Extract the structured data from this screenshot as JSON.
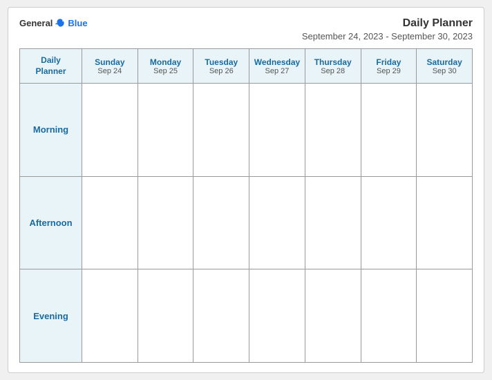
{
  "header": {
    "logo_general": "General",
    "logo_blue": "Blue",
    "title": "Daily Planner",
    "date_range": "September 24, 2023 - September 30, 2023"
  },
  "grid": {
    "corner_label_line1": "Daily",
    "corner_label_line2": "Planner",
    "days": [
      {
        "name": "Sunday",
        "date": "Sep 24"
      },
      {
        "name": "Monday",
        "date": "Sep 25"
      },
      {
        "name": "Tuesday",
        "date": "Sep 26"
      },
      {
        "name": "Wednesday",
        "date": "Sep 27"
      },
      {
        "name": "Thursday",
        "date": "Sep 28"
      },
      {
        "name": "Friday",
        "date": "Sep 29"
      },
      {
        "name": "Saturday",
        "date": "Sep 30"
      }
    ],
    "rows": [
      {
        "label": "Morning"
      },
      {
        "label": "Afternoon"
      },
      {
        "label": "Evening"
      }
    ]
  }
}
